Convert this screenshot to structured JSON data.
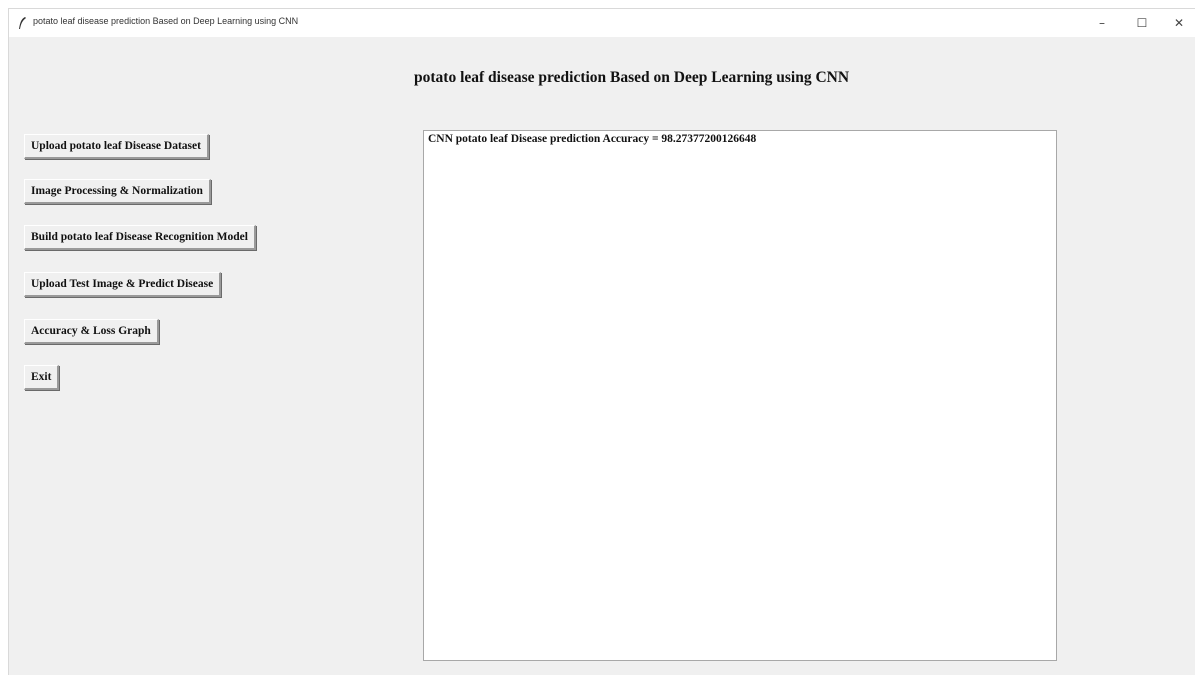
{
  "window": {
    "title": "potato leaf disease prediction Based on Deep Learning using CNN",
    "icon": "feather-icon",
    "controls": {
      "minimize": "–",
      "maximize": "☐",
      "close": "✕"
    }
  },
  "main": {
    "heading": "potato leaf disease prediction Based on Deep Learning using CNN",
    "output_text": "CNN potato leaf Disease prediction Accuracy = 98.27377200126648"
  },
  "buttons": {
    "upload_dataset": "Upload potato leaf Disease Dataset",
    "image_processing": "Image Processing & Normalization",
    "build_model": "Build potato leaf Disease Recognition Model",
    "upload_test": "Upload Test Image & Predict Disease",
    "graph": "Accuracy & Loss Graph",
    "exit": "Exit"
  }
}
